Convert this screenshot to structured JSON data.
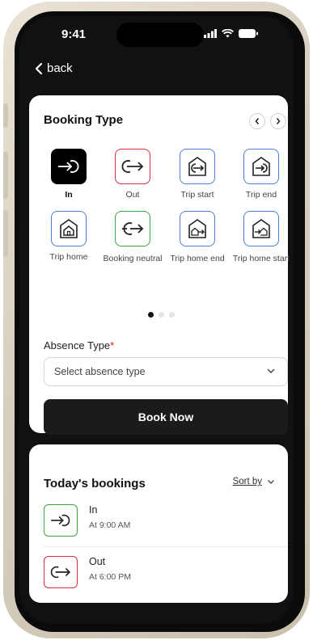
{
  "status_bar": {
    "time": "9:41"
  },
  "nav": {
    "back_label": "back"
  },
  "booking_type": {
    "title": "Booking Type",
    "types": [
      {
        "label": "In",
        "icon": "arrow-in-icon",
        "style": "selected"
      },
      {
        "label": "Out",
        "icon": "arrow-out-icon",
        "style": "red"
      },
      {
        "label": "Trip start",
        "icon": "trip-start-icon",
        "style": "blue"
      },
      {
        "label": "Trip end",
        "icon": "trip-end-icon",
        "style": "blue"
      },
      {
        "label": "Trip home",
        "icon": "trip-home-icon",
        "style": "blue"
      },
      {
        "label": "Booking neutral",
        "icon": "booking-neutral-icon",
        "style": "green"
      },
      {
        "label": "Trip home end",
        "icon": "trip-home-end-icon",
        "style": "blue"
      },
      {
        "label": "Trip home start",
        "icon": "trip-home-start-icon",
        "style": "blue"
      }
    ],
    "pages": 3,
    "active_page": 1
  },
  "absence": {
    "label": "Absence Type",
    "required_mark": "*",
    "placeholder": "Select absence type"
  },
  "book_button": "Book Now",
  "todays_bookings": {
    "title": "Today's bookings",
    "sort_label": "Sort by",
    "items": [
      {
        "name": "In",
        "time": "At 9:00 AM",
        "icon": "arrow-in-icon",
        "color": "#3aa63a"
      },
      {
        "name": "Out",
        "time": "At 6:00 PM",
        "icon": "arrow-out-icon",
        "color": "#d62e3c"
      }
    ]
  },
  "colors": {
    "red": "#d62e3c",
    "blue": "#4a7fd6",
    "green": "#3aa63a",
    "selected": "#000000"
  }
}
